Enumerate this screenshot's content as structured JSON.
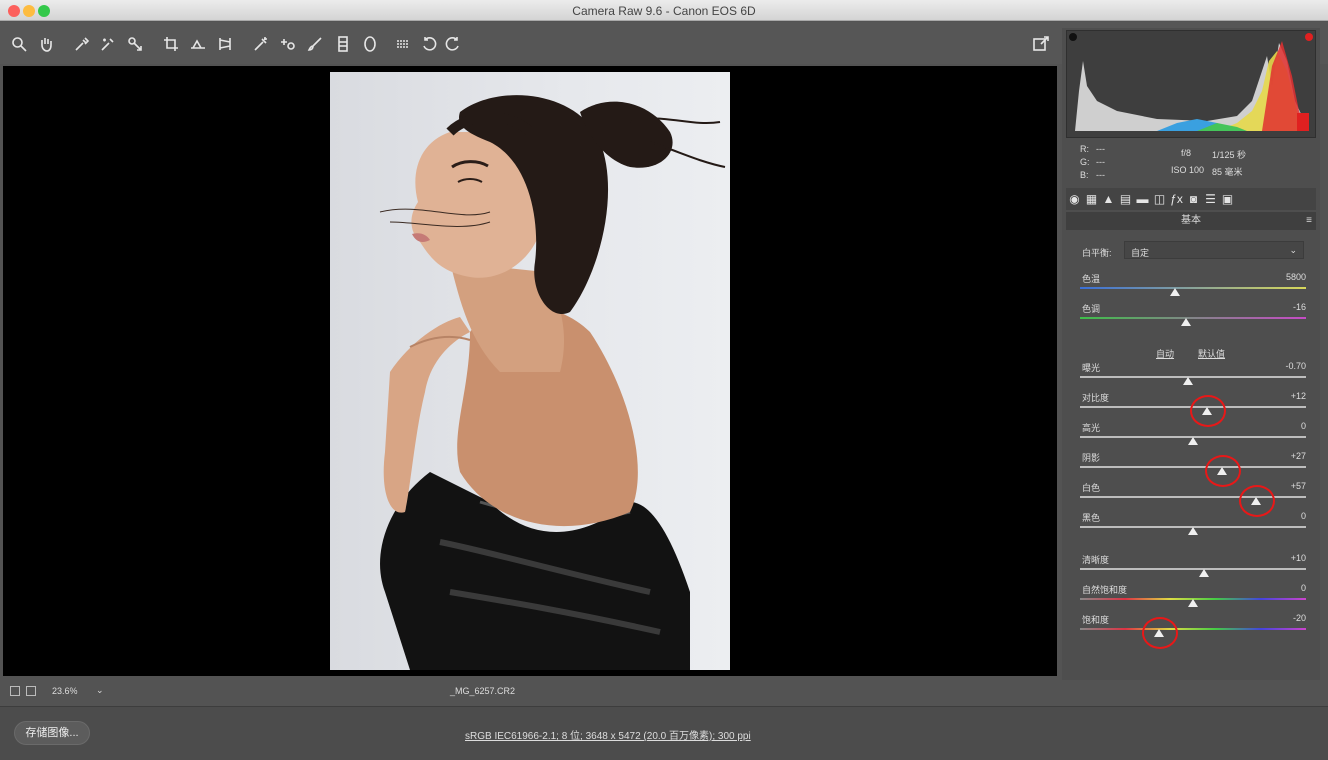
{
  "window": {
    "title": "Camera Raw 9.6 - Canon EOS 6D"
  },
  "toolbar": {
    "icons": [
      "zoom-icon",
      "hand-icon",
      "white-balance-icon",
      "color-sampler-icon",
      "target-adjust-icon",
      "crop-icon",
      "straighten-icon",
      "transform-icon",
      "spot-removal-icon",
      "red-eye-icon",
      "adjustment-brush-icon",
      "graduated-filter-icon",
      "radial-filter-icon",
      "preferences-icon",
      "rotate-left-icon",
      "rotate-right-icon"
    ]
  },
  "histogram": {
    "rgb_r": "R:",
    "rgb_g": "G:",
    "rgb_b": "B:",
    "dash": "---",
    "aperture": "f/8",
    "shutter": "1/125 秒",
    "iso": "ISO 100",
    "focal": "85 毫米"
  },
  "panel": {
    "section_title": "基本",
    "wb_label": "白平衡:",
    "wb_value": "自定",
    "auto_label": "自动",
    "default_label": "默认值",
    "sliders": [
      {
        "label": "色温",
        "value": "5800",
        "pos": 0.42,
        "grad": "temp"
      },
      {
        "label": "色调",
        "value": "-16",
        "pos": 0.47,
        "grad": "tint"
      },
      {
        "label": "曝光",
        "value": "-0.70",
        "pos": 0.48,
        "grad": "none"
      },
      {
        "label": "对比度",
        "value": "+12",
        "pos": 0.56,
        "grad": "none"
      },
      {
        "label": "高光",
        "value": "0",
        "pos": 0.5,
        "grad": "none"
      },
      {
        "label": "阴影",
        "value": "+27",
        "pos": 0.63,
        "grad": "none"
      },
      {
        "label": "白色",
        "value": "+57",
        "pos": 0.78,
        "grad": "none"
      },
      {
        "label": "黑色",
        "value": "0",
        "pos": 0.5,
        "grad": "none"
      },
      {
        "label": "清晰度",
        "value": "+10",
        "pos": 0.55,
        "grad": "none"
      },
      {
        "label": "自然饱和度",
        "value": "0",
        "pos": 0.5,
        "grad": "sat"
      },
      {
        "label": "饱和度",
        "value": "-20",
        "pos": 0.35,
        "grad": "sat"
      }
    ]
  },
  "status": {
    "zoom": "23.6%",
    "filename": "_MG_6257.CR2"
  },
  "bottom": {
    "save_label": "存储图像...",
    "workflow": "sRGB IEC61966-2.1; 8 位; 3648 x 5472 (20.0 百万像素); 300 ppi"
  }
}
